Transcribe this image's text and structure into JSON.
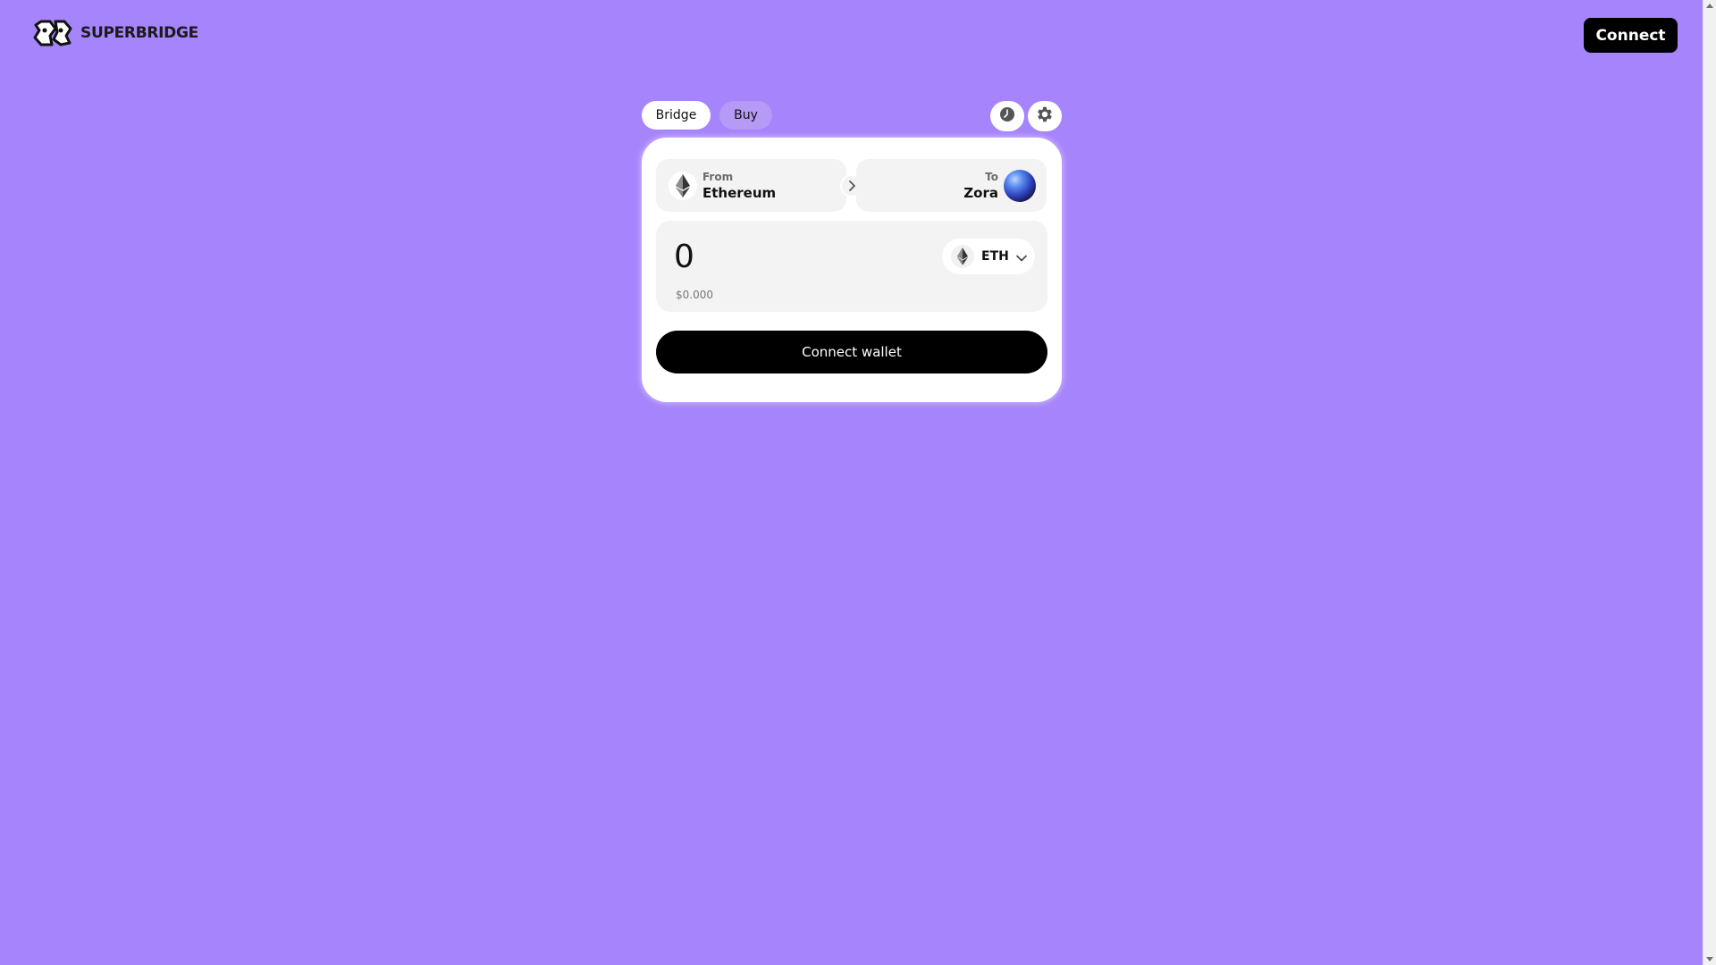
{
  "header": {
    "logo_text": "SUPERBRIDGE",
    "connect_label": "Connect"
  },
  "tabs": [
    {
      "label": "Bridge",
      "active": true
    },
    {
      "label": "Buy",
      "active": false
    }
  ],
  "icons": {
    "recent": "clock-icon",
    "settings": "gear-icon"
  },
  "route": {
    "from_label": "From",
    "from_network": "Ethereum",
    "to_label": "To",
    "to_network": "Zora"
  },
  "amount": {
    "value": "0",
    "usd_value": "$0.000",
    "token_symbol": "ETH"
  },
  "action": {
    "connect_wallet_label": "Connect wallet"
  },
  "colors": {
    "background": "#a684fb",
    "card": "#ffffff",
    "primary_button": "#000000"
  }
}
